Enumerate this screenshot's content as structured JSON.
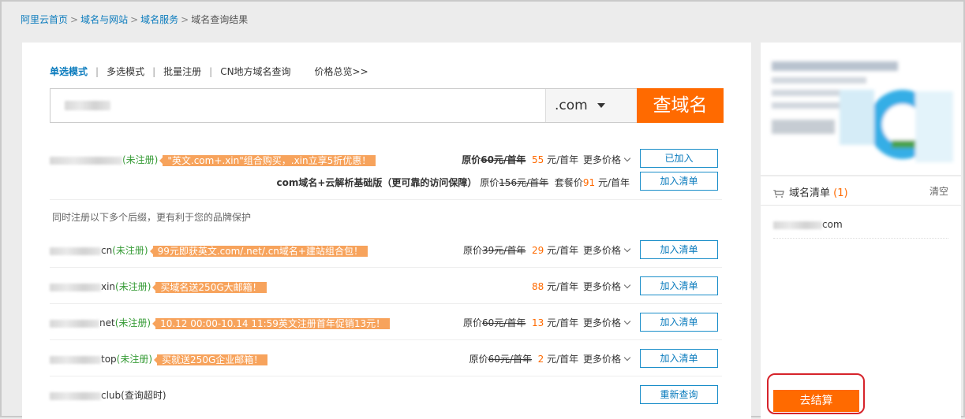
{
  "breadcrumb": {
    "home": "阿里云首页",
    "domains": "域名与网站",
    "service": "域名服务",
    "current": "域名查询结果"
  },
  "modes": {
    "single": "单选模式",
    "multi": "多选模式",
    "batch": "批量注册",
    "cn_local": "CN地方域名查询",
    "prices": "价格总览>>"
  },
  "search": {
    "tld": ".com",
    "button": "查域名"
  },
  "results": {
    "com": {
      "suffix": "",
      "status": "(未注册)",
      "promo": "\"英文.com+.xin\"组合购买，.xin立享5折优惠！",
      "price_label": "原价",
      "original": "60元/首年",
      "price": "55",
      "price_unit": "元/首年",
      "more": "更多价格",
      "button": "已加入"
    },
    "bundle": {
      "title": "com域名+云解析基础版（更可靠的访问保障）",
      "orig_label": "原价",
      "original": "156元/首年",
      "combo_label": "套餐价",
      "price": "91",
      "unit": "元/首年",
      "button": "加入清单"
    },
    "tip": "同时注册以下多个后缀，更有利于您的品牌保护",
    "cn": {
      "suffix": "cn",
      "status": "(未注册)",
      "promo": "99元即获英文.com/.net/.cn域名+建站组合包！",
      "price_label": "原价",
      "original": "39元/首年",
      "price": "29",
      "price_unit": "元/首年",
      "more": "更多价格",
      "button": "加入清单"
    },
    "xin": {
      "suffix": "xin",
      "status": "(未注册)",
      "promo": "买域名送250G大邮箱！",
      "price": "88",
      "price_unit": "元/首年",
      "more": "更多价格",
      "button": "加入清单"
    },
    "net": {
      "suffix": "net",
      "status": "(未注册)",
      "promo": "10.12 00:00-10.14 11:59英文注册首年促销13元！",
      "price_label": "原价",
      "original": "60元/首年",
      "price": "13",
      "price_unit": "元/首年",
      "more": "更多价格",
      "button": "加入清单"
    },
    "top": {
      "suffix": "top",
      "status": "(未注册)",
      "promo": "买就送250G企业邮箱！",
      "price_label": "原价",
      "original": "60元/首年",
      "price": "2",
      "price_unit": "元/首年",
      "more": "更多价格",
      "button": "加入清单"
    },
    "club": {
      "suffix": "club",
      "status": "(查询超时)",
      "button": "重新查询"
    }
  },
  "cart": {
    "title": "域名清单",
    "count": "(1)",
    "clear": "清空",
    "item_suffix": "com",
    "checkout": "去结算"
  },
  "colors": {
    "accent": "#ff6a00",
    "link": "#0a7bbd",
    "status_green": "#359b35",
    "promo_bg": "#f7a35c"
  }
}
